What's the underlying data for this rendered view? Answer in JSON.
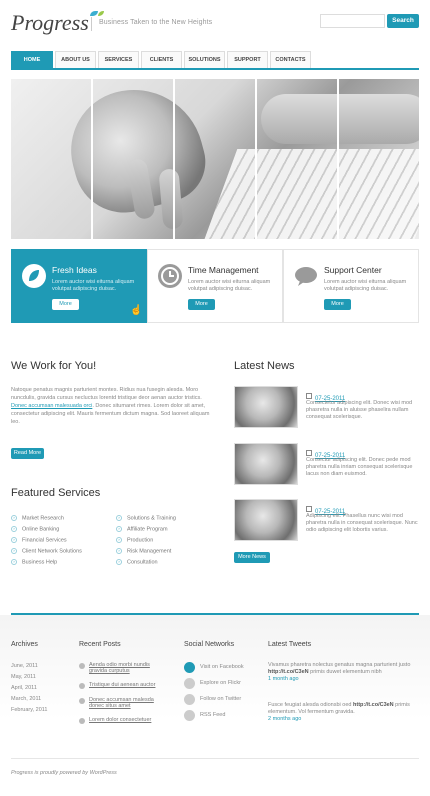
{
  "header": {
    "logo": "Progress",
    "tagline": "Business Taken to the New Heights",
    "search_button": "Search"
  },
  "nav": [
    "HOME",
    "ABOUT US",
    "SERVICES",
    "CLIENTS",
    "SOLUTIONS",
    "SUPPORT",
    "CONTACTS"
  ],
  "features": [
    {
      "title": "Fresh Ideas",
      "text": "Lorem auctor wisi eiturna aliquam volutpat adipiscing duisac.",
      "button": "More",
      "icon": "leaf-icon"
    },
    {
      "title": "Time Management",
      "text": "Lorem auctor wisi eiturna aliquam volutpat adipiscing duisac.",
      "button": "More",
      "icon": "clock-icon"
    },
    {
      "title": "Support Center",
      "text": "Lorem auctor wisi eiturna aliquam volutpat adipiscing duisac.",
      "button": "More",
      "icon": "speech-bubble-icon"
    }
  ],
  "work": {
    "title": "We Work for You!",
    "p1": "Natoque penatus magnis parturient montes. Ridius nua fusegin alesda. Moro nuncdulis, gravida cursus necluctus lorentd tristique deor aenan auctor tristics.",
    "link": "Donec accumsan malesuada orci",
    "p2": ". Donec situmaret rimes. Lorem dolor sit amet, consectetur adipiscing elit. Mauris fermentum dictum magna. Sod laoreet aliquam leo.",
    "button": "Read More"
  },
  "services": {
    "title": "Featured Services",
    "col1": [
      "Market Research",
      "Online Banking",
      "Financial Services",
      "Client Network Solutions",
      "Business Help"
    ],
    "col2": [
      "Solutions & Training",
      "Affiliate Program",
      "Production",
      "Risk Management",
      "Consultation"
    ]
  },
  "news": {
    "title": "Latest News",
    "items": [
      {
        "date": "07-25-2011",
        "text": "Consectetur adipiscing elit. Donec wisi mod phasretra nulla in aluisse phaselira nullam consequat scelerisque."
      },
      {
        "date": "07-25-2011",
        "text": "Consectur adipiscing elit. Donec pede mod pharetra nulla inriam consequat scelerisque lacus non diam euismod."
      },
      {
        "date": "07-25-2011",
        "text": "Adipiscing elit. Phasellus nunc wisi mod pharetra nulla in consequat scelerisque. Nunc odio adipiscing elit lobortis varius."
      }
    ],
    "button": "More News"
  },
  "footer": {
    "archives": {
      "title": "Archives",
      "items": [
        "June, 2011",
        "May, 2011",
        "April, 2011",
        "March, 2011",
        "February, 2011"
      ]
    },
    "posts": {
      "title": "Recent Posts",
      "items": [
        "Aenda odio morbi nundis gravida curputus",
        "Tristique dui aenean auctor",
        "Donec accumsan malesda donec situs amet",
        "Lorem dolor consectetuer"
      ]
    },
    "social": {
      "title": "Social Networks",
      "items": [
        "Visit on Facebook",
        "Explore on Flickr",
        "Follow on Twitter",
        "RSS Feed"
      ]
    },
    "tweets": {
      "title": "Latest Tweets",
      "items": [
        {
          "text": "Vivamus pharetra nolectus genatus magna parturient justo",
          "link": "http://t.co/C3eN",
          "rest": " primis duwet elementum nibh",
          "ago": "1 month ago"
        },
        {
          "text": "Fusce feugiat alesda odionsbi oed",
          "link": "http://t.co/C3eN",
          "rest": " primis elementum. Vol fermentum gravida.",
          "ago": "2 months ago"
        }
      ]
    },
    "copyright": "Progress is proudly powered by WordPress"
  }
}
